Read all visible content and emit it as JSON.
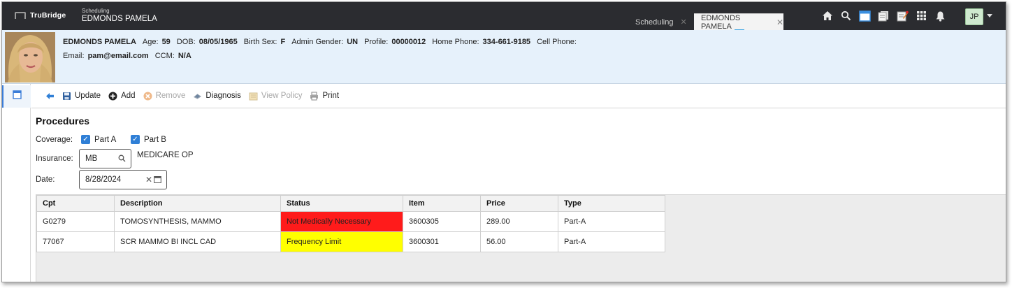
{
  "header": {
    "brand": "TruBridge",
    "module": "Scheduling",
    "patient_name": "EDMONDS PAMELA",
    "tabs": [
      {
        "label": "Scheduling",
        "active": false
      },
      {
        "label": "EDMONDS PAMELA",
        "active": true
      }
    ],
    "icons": [
      "home-icon",
      "search-icon",
      "calendar-window-icon",
      "documents-icon",
      "notes-icon",
      "apps-grid-icon",
      "bell-icon"
    ],
    "user_initials": "JP"
  },
  "patient": {
    "name": "EDMONDS PAMELA",
    "age_label": "Age:",
    "age": "59",
    "dob_label": "DOB:",
    "dob": "08/05/1965",
    "birth_sex_label": "Birth Sex:",
    "birth_sex": "F",
    "admin_gender_label": "Admin Gender:",
    "admin_gender": "UN",
    "profile_label": "Profile:",
    "profile": "00000012",
    "home_phone_label": "Home Phone:",
    "home_phone": "334-661-9185",
    "cell_phone_label": "Cell Phone:",
    "cell_phone": "",
    "email_label": "Email:",
    "email": "pam@email.com",
    "ccm_label": "CCM:",
    "ccm": "N/A"
  },
  "toolbar": {
    "update": "Update",
    "add": "Add",
    "remove": "Remove",
    "diagnosis": "Diagnosis",
    "view_policy": "View Policy",
    "print": "Print"
  },
  "procedures": {
    "title": "Procedures",
    "coverage_label": "Coverage:",
    "part_a_label": "Part A",
    "part_a_checked": true,
    "part_b_label": "Part B",
    "part_b_checked": true,
    "insurance_label": "Insurance:",
    "insurance_value": "MB",
    "insurance_desc": "MEDICARE OP",
    "date_label": "Date:",
    "date_value": "8/28/2024",
    "columns": [
      "Cpt",
      "Description",
      "Status",
      "Item",
      "Price",
      "Type"
    ],
    "rows": [
      {
        "cpt": "G0279",
        "description": "TOMOSYNTHESIS, MAMMO",
        "status": "Not Medically Necessary",
        "status_color": "#ff1b1b",
        "item": "3600305",
        "price": "289.00",
        "type": "Part-A"
      },
      {
        "cpt": "77067",
        "description": "SCR MAMMO BI INCL CAD",
        "status": "Frequency Limit",
        "status_color": "#ffff00",
        "item": "3600301",
        "price": "56.00",
        "type": "Part-A"
      }
    ]
  },
  "colors": {
    "topbar": "#2b2c30",
    "banner": "#e6f1fb",
    "accent": "#2f7fd6",
    "status_red": "#ff1b1b",
    "status_yellow": "#ffff00"
  }
}
